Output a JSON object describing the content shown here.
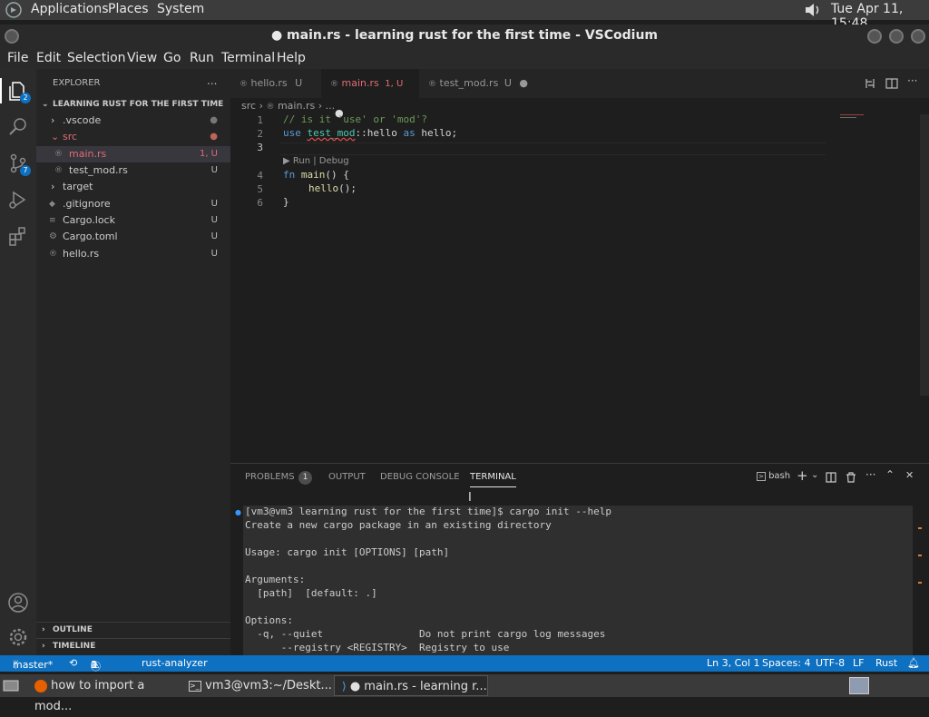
{
  "topbar": {
    "applications": "Applications",
    "places": "Places",
    "system": "System",
    "clock": "Tue Apr 11, 15:48"
  },
  "window": {
    "title": "● main.rs - learning rust for the first time - VSCodium"
  },
  "menu": [
    "File",
    "Edit",
    "Selection",
    "View",
    "Go",
    "Run",
    "Terminal",
    "Help"
  ],
  "activity": {
    "explorer_badge": "2",
    "scm_badge": "7"
  },
  "explorer": {
    "title": "EXPLORER",
    "more": "...",
    "folder": "LEARNING RUST FOR THE FIRST TIME",
    "items": [
      {
        "name": ".vscode",
        "status": "●"
      },
      {
        "name": "src",
        "status": "●"
      },
      {
        "name": "main.rs",
        "status": "1, U"
      },
      {
        "name": "test_mod.rs",
        "status": "U"
      },
      {
        "name": "target",
        "status": ""
      },
      {
        "name": ".gitignore",
        "status": "U"
      },
      {
        "name": "Cargo.lock",
        "status": "U"
      },
      {
        "name": "Cargo.toml",
        "status": "U"
      },
      {
        "name": "hello.rs",
        "status": "U"
      }
    ],
    "outline": "OUTLINE",
    "timeline": "TIMELINE"
  },
  "tabs": [
    {
      "name": "hello.rs",
      "status": "U"
    },
    {
      "name": "main.rs",
      "status": "1, U"
    },
    {
      "name": "test_mod.rs",
      "status": "U"
    }
  ],
  "breadcrumb": {
    "folder": "src",
    "sep1": "›",
    "file": "main.rs",
    "sep2": "›",
    "more": "..."
  },
  "editor": {
    "line_numbers": [
      "1",
      "2",
      "3",
      "4",
      "5",
      "6"
    ],
    "line1": "// is it 'use' or 'mod'?",
    "line2_kw": "use",
    "line2_mod": "test_mod",
    "line2_rest": "::hello",
    "line2_as": "as",
    "line2_end": "hello;",
    "codelens": "▶ Run | Debug",
    "line4_fn": "fn",
    "line4_name": "main",
    "line4_rest": "() {",
    "line5_call": "hello",
    "line5_rest": "();",
    "line6": "}"
  },
  "panel": {
    "problems": "PROBLEMS",
    "problems_count": "1",
    "output": "OUTPUT",
    "debug_console": "DEBUG CONSOLE",
    "terminal": "TERMINAL",
    "shell": "bash"
  },
  "terminal_lines": [
    "[vm3@vm3 learning rust for the first time]$ cargo init --help",
    "Create a new cargo package in an existing directory",
    "",
    "Usage: cargo init [OPTIONS] [path]",
    "",
    "Arguments:",
    "  [path]  [default: .]",
    "",
    "Options:",
    "  -q, --quiet                Do not print cargo log messages",
    "      --registry <REGISTRY>  Registry to use"
  ],
  "status": {
    "branch": "master*",
    "errors": "1",
    "warnings": "0",
    "analyzer": "rust-analyzer",
    "position": "Ln 3, Col 1",
    "spaces": "Spaces: 4",
    "encoding": "UTF-8",
    "eol": "LF",
    "language": "Rust"
  },
  "taskbar": {
    "firefox": "how to import a mod...",
    "terminal": "vm3@vm3:~/Deskt...",
    "vscodium": "● main.rs - learning r..."
  }
}
